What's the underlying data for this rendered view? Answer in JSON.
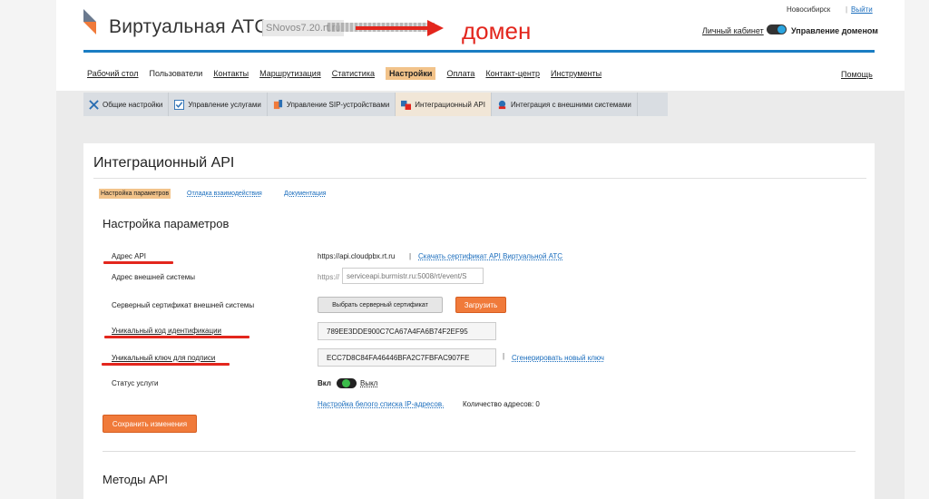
{
  "header": {
    "app_title": "Виртуальная АТС",
    "domain": "SNovos7.20.rt.ru",
    "annotation": "домен",
    "city": "Новосибирск",
    "separator": "|",
    "logout": "Выйти",
    "cabinet": "Личный кабинет",
    "manage_domain": "Управление доменом"
  },
  "nav": {
    "items": [
      "Рабочий стол",
      "Пользователи",
      "Контакты",
      "Маршрутизация",
      "Статистика",
      "Настройки",
      "Оплата",
      "Контакт-центр",
      "Инструменты"
    ],
    "active": "Настройки",
    "help": "Помощь"
  },
  "subnav": {
    "items": [
      "Общие настройки",
      "Управление услугами",
      "Управление SIP-устройствами",
      "Интеграционный API",
      "Интеграция с внешними системами"
    ],
    "active": "Интеграционный API"
  },
  "panel": {
    "title": "Интеграционный API",
    "tabs": [
      "Настройка параметров",
      "Отладка взаимодействия",
      "Документация"
    ],
    "section_title": "Настройка параметров",
    "labels": {
      "api_address": "Адрес API",
      "ext_address": "Адрес внешней системы",
      "server_cert": "Серверный сертификат внешней системы",
      "unique_code": "Уникальный код идентификации",
      "signing_key": "Уникальный ключ для подписи",
      "status": "Статус услуги"
    },
    "api_url": "https://api.cloudpbx.rt.ru",
    "api_sep": "|",
    "api_cert_link": "Скачать сертификат API Виртуальной АТС",
    "https_prefix": "https://",
    "ext_placeholder": "serviceapi.burmistr.ru:5008/rt/event/S",
    "select_cert_button": "Выбрать серверный сертификат",
    "upload_button": "Загрузить",
    "unique_code_value": "789EE3DDE900C7CA67A4FA6B74F2EF95",
    "signing_key_value": "ECC7D8C84FA46446BFA2C7FBFAC907FE",
    "gen_sep": "|",
    "generate_link": "Сгенерировать новый ключ",
    "status_on": "Вкл",
    "status_off": "Выкл",
    "whitelist_link": "Настройка белого списка IP-адресов.",
    "addr_count": "Количество адресов: 0",
    "save_button": "Сохранить изменения",
    "methods_title": "Методы API"
  },
  "colors": {
    "accent_blue": "#1a7dc3",
    "active_tab": "#f2c38a",
    "button_orange": "#f07a3a",
    "annotation_red": "#e3261d"
  }
}
